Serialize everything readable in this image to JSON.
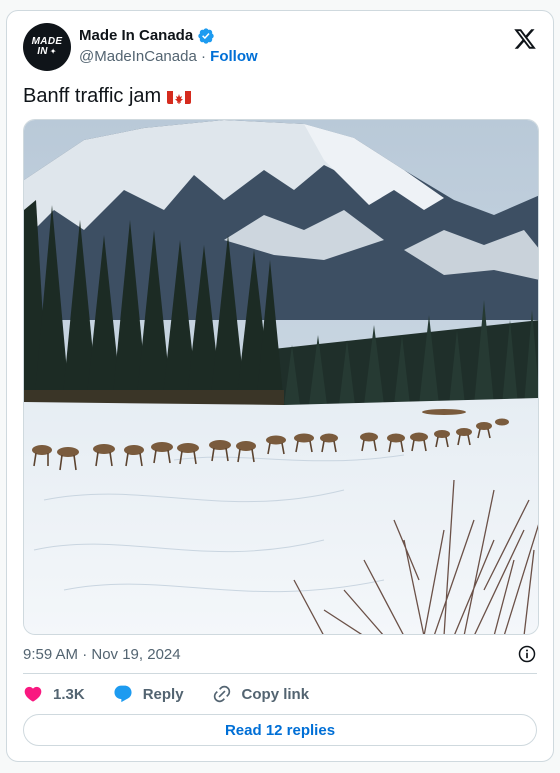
{
  "author": {
    "avatar_line1": "MADE",
    "avatar_line2": "IN",
    "display_name": "Made In Canada",
    "handle": "@MadeInCanada",
    "separator": "·",
    "follow_label": "Follow",
    "verified": true
  },
  "tweet": {
    "text": "Banff traffic jam",
    "emoji": "canadian-flag",
    "timestamp": "9:59 AM · Nov 19, 2024"
  },
  "actions": {
    "likes": "1.3K",
    "reply_label": "Reply",
    "copy_label": "Copy link"
  },
  "read_replies_label": "Read 12 replies",
  "icons": [
    "x-logo-icon",
    "verified-badge-icon",
    "info-icon",
    "heart-icon",
    "reply-bubble-icon",
    "link-icon"
  ],
  "colors": {
    "accent": "#006fd6",
    "verified": "#1d9bf0",
    "heart": "#f91880",
    "text": "#0f1419",
    "muted": "#536471",
    "border": "#cfd9de"
  }
}
